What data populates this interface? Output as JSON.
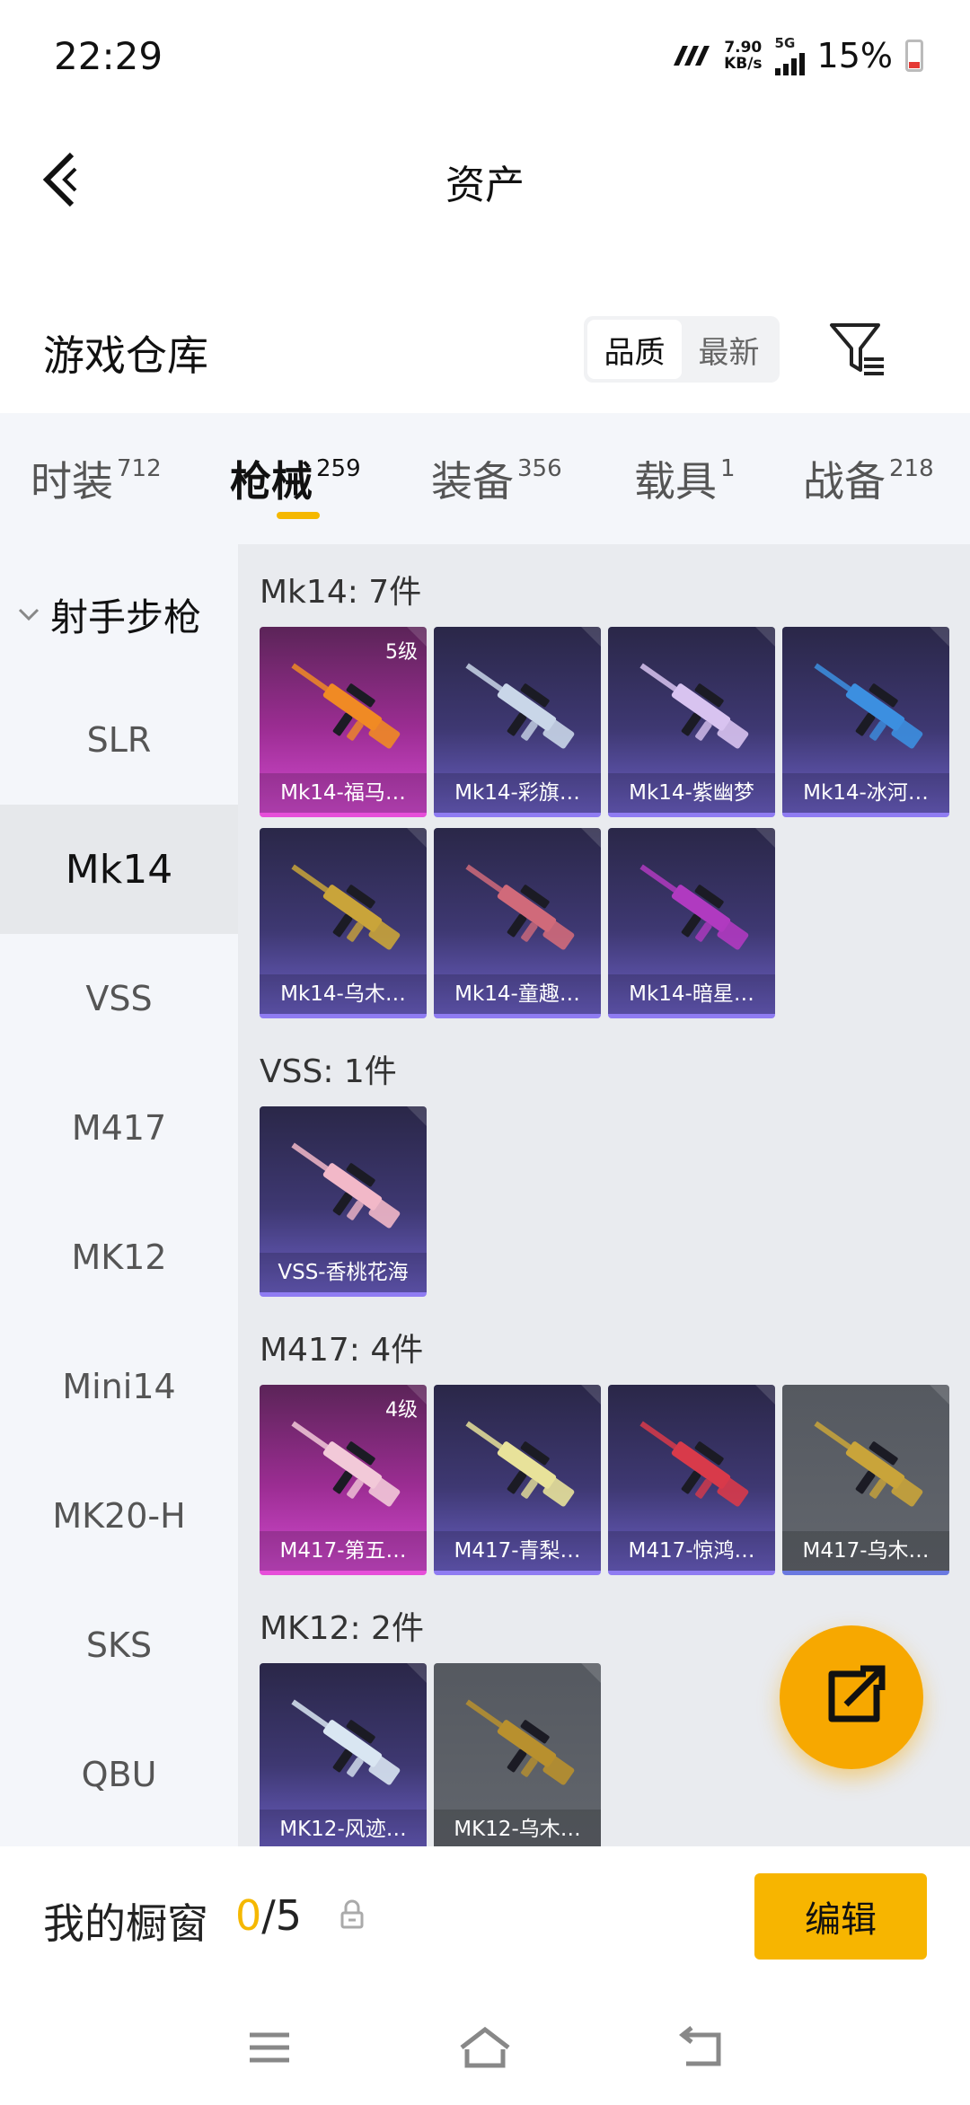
{
  "status": {
    "time": "22:29",
    "net_speed": "7.90",
    "net_unit": "KB/s",
    "network": "5G",
    "battery": "15%"
  },
  "header": {
    "title": "资产"
  },
  "section": {
    "title": "游戏仓库",
    "sort_options": [
      "品质",
      "最新"
    ],
    "active_sort": "品质"
  },
  "tabs": [
    {
      "label": "时装",
      "count": "712"
    },
    {
      "label": "枪械",
      "count": "259"
    },
    {
      "label": "装备",
      "count": "356"
    },
    {
      "label": "载具",
      "count": "1"
    },
    {
      "label": "战备",
      "count": "218"
    }
  ],
  "sidebar": {
    "group": "射手步枪",
    "items": [
      "SLR",
      "Mk14",
      "VSS",
      "M417",
      "MK12",
      "Mini14",
      "MK20-H",
      "SKS",
      "QBU"
    ],
    "active": "Mk14"
  },
  "groups": [
    {
      "label": "Mk14: 7件",
      "items": [
        {
          "name": "Mk14-福马…",
          "level": "5级",
          "rarity": "legendary",
          "gun_color": "#f08a24"
        },
        {
          "name": "Mk14-彩旗…",
          "level": "",
          "rarity": "epic",
          "gun_color": "#c9d6e8"
        },
        {
          "name": "Mk14-紫幽梦",
          "level": "",
          "rarity": "epic",
          "gun_color": "#d8c3f0"
        },
        {
          "name": "Mk14-冰河…",
          "level": "",
          "rarity": "epic",
          "gun_color": "#3c8fe0"
        },
        {
          "name": "Mk14-乌木…",
          "level": "",
          "rarity": "epic",
          "gun_color": "#c9a43a"
        },
        {
          "name": "Mk14-童趣…",
          "level": "",
          "rarity": "epic",
          "gun_color": "#d06a7a"
        },
        {
          "name": "Mk14-暗星…",
          "level": "",
          "rarity": "epic",
          "gun_color": "#b03ac0"
        }
      ]
    },
    {
      "label": "VSS: 1件",
      "items": [
        {
          "name": "VSS-香桃花海",
          "level": "",
          "rarity": "epic",
          "gun_color": "#f2b8c8"
        }
      ]
    },
    {
      "label": "M417: 4件",
      "items": [
        {
          "name": "M417-第五…",
          "level": "4级",
          "rarity": "legendary",
          "gun_color": "#f2c9d8"
        },
        {
          "name": "M417-青梨…",
          "level": "",
          "rarity": "epic",
          "gun_color": "#e8e29a"
        },
        {
          "name": "M417-惊鸿…",
          "level": "",
          "rarity": "epic",
          "gun_color": "#d83a4a"
        },
        {
          "name": "M417-乌木…",
          "level": "",
          "rarity": "common",
          "gun_color": "#c9a43a"
        }
      ]
    },
    {
      "label": "MK12: 2件",
      "items": [
        {
          "name": "MK12-风迹…",
          "level": "",
          "rarity": "epic",
          "gun_color": "#d9e6f2"
        },
        {
          "name": "MK12-乌木…",
          "level": "",
          "rarity": "common",
          "gun_color": "#b8902e"
        }
      ]
    }
  ],
  "showcase": {
    "label": "我的橱窗",
    "current": "0",
    "total": "/5",
    "edit_label": "编辑"
  },
  "colors": {
    "accent": "#f5b800",
    "epic": "#8f7cf2",
    "legendary": "#d24ad0"
  },
  "icons": [
    "back-arrow-icon",
    "filter-icon",
    "share-icon",
    "lock-icon",
    "menu-icon",
    "home-icon",
    "return-icon"
  ]
}
